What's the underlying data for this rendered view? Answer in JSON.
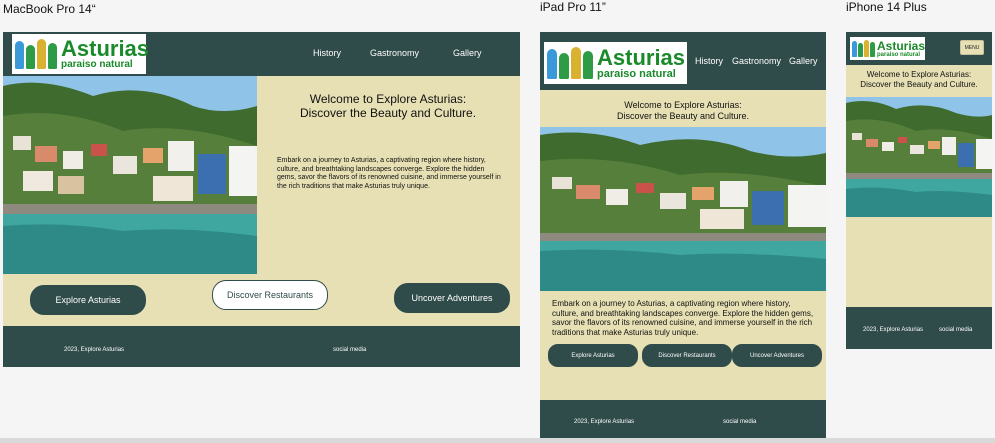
{
  "frames": {
    "macbook": {
      "label": "MacBook Pro 14“"
    },
    "ipad": {
      "label": "iPad Pro 11”"
    },
    "iphone": {
      "label": "iPhone 14 Plus"
    }
  },
  "logo": {
    "title": "Asturias",
    "subtitle": "paraiso natural"
  },
  "nav": {
    "history": "History",
    "gastronomy": "Gastronomy",
    "gallery": "Gallery",
    "menu": "MENU"
  },
  "welcome": {
    "line1": "Welcome to Explore Asturias:",
    "line2": "Discover the Beauty and Culture."
  },
  "intro": "Embark on a journey to Asturias, a captivating region where history, culture, and breathtaking landscapes converge. Explore the hidden gems, savor the flavors of its renowned cuisine, and immerse yourself in the rich traditions that make Asturias truly unique.",
  "buttons": {
    "explore": "Explore Asturias",
    "restaurants": "Discover Restaurants",
    "adventures": "Uncover Adventures"
  },
  "footer": {
    "copyright": "2023, Explore Asturias",
    "social": "social media"
  },
  "colors": {
    "primary": "#2f4b4a",
    "sand": "#e7e0b4",
    "logo_green": "#1a8a2a"
  },
  "photo": {
    "subject": "coastal-village-harbor"
  }
}
